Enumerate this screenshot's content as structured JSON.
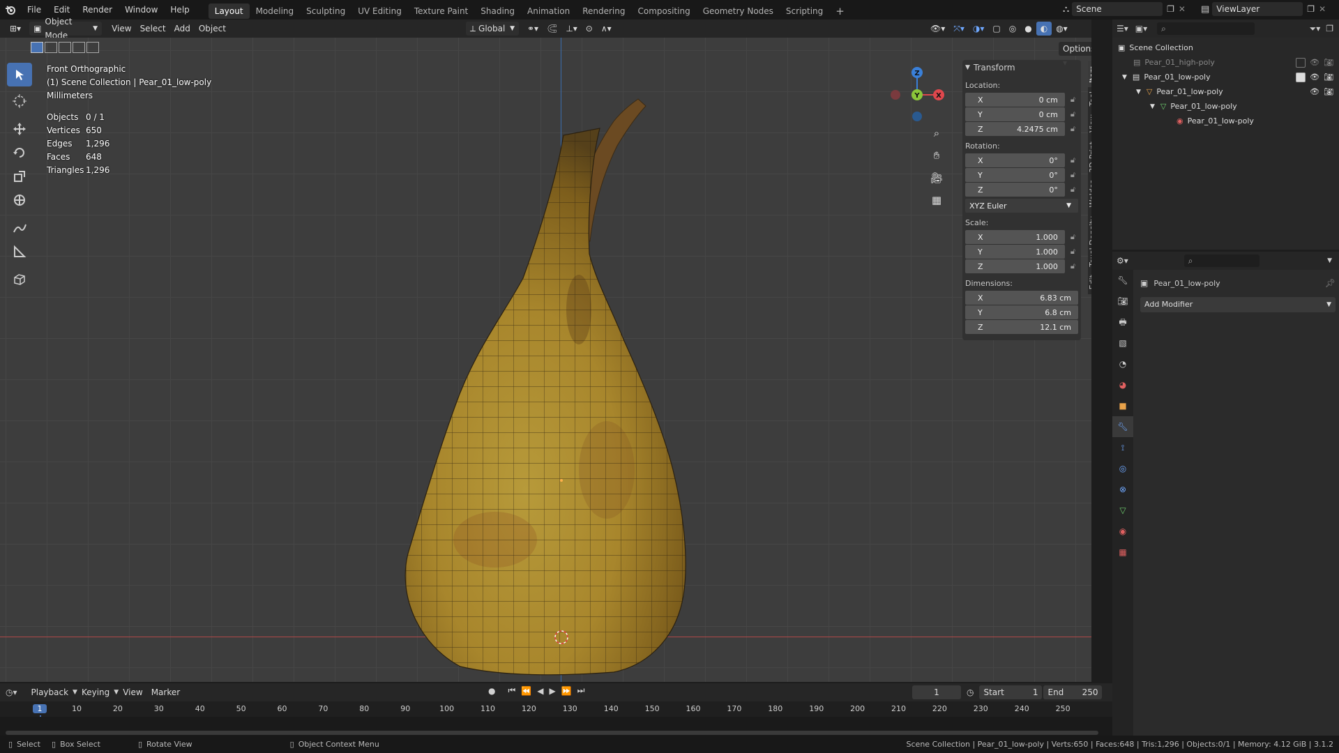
{
  "menubar": {
    "items": [
      "File",
      "Edit",
      "Render",
      "Window",
      "Help"
    ],
    "workspaces": [
      "Layout",
      "Modeling",
      "Sculpting",
      "UV Editing",
      "Texture Paint",
      "Shading",
      "Animation",
      "Rendering",
      "Compositing",
      "Geometry Nodes",
      "Scripting"
    ],
    "active_workspace": "Layout",
    "add_tab": "+",
    "scene_name": "Scene",
    "view_layer": "ViewLayer"
  },
  "viewport_header": {
    "mode": "Object Mode",
    "menus": [
      "View",
      "Select",
      "Add",
      "Object"
    ],
    "transform_orientation": "Global",
    "options_label": "Options"
  },
  "viewport_overlay": {
    "view_name": "Front Orthographic",
    "collection_path": "(1) Scene Collection | Pear_01_low-poly",
    "units": "Millimeters",
    "stats": [
      {
        "label": "Objects",
        "value": "0 / 1"
      },
      {
        "label": "Vertices",
        "value": "650"
      },
      {
        "label": "Edges",
        "value": "1,296"
      },
      {
        "label": "Faces",
        "value": "648"
      },
      {
        "label": "Triangles",
        "value": "1,296"
      }
    ]
  },
  "gizmo": {
    "z": "Z",
    "y": "Y",
    "x": "X"
  },
  "npanel": {
    "header": "Transform",
    "location_label": "Location:",
    "location": [
      {
        "axis": "X",
        "value": "0 cm"
      },
      {
        "axis": "Y",
        "value": "0 cm"
      },
      {
        "axis": "Z",
        "value": "4.2475 cm"
      }
    ],
    "rotation_label": "Rotation:",
    "rotation": [
      {
        "axis": "X",
        "value": "0°"
      },
      {
        "axis": "Y",
        "value": "0°"
      },
      {
        "axis": "Z",
        "value": "0°"
      }
    ],
    "rotation_mode": "XYZ Euler",
    "scale_label": "Scale:",
    "scale": [
      {
        "axis": "X",
        "value": "1.000"
      },
      {
        "axis": "Y",
        "value": "1.000"
      },
      {
        "axis": "Z",
        "value": "1.000"
      }
    ],
    "dimensions_label": "Dimensions:",
    "dimensions": [
      {
        "axis": "X",
        "value": "6.83 cm"
      },
      {
        "axis": "Y",
        "value": "6.8 cm"
      },
      {
        "axis": "Z",
        "value": "12.1 cm"
      }
    ]
  },
  "sidebar_tabs": [
    "Item",
    "Tool",
    "View",
    "3D-Print",
    "Welder",
    "Texel Density",
    "Edit"
  ],
  "outliner": {
    "root": "Scene Collection",
    "items": [
      {
        "name": "Pear_01_high-poly",
        "level": 1,
        "dim": true
      },
      {
        "name": "Pear_01_low-poly",
        "level": 1,
        "dim": false
      },
      {
        "name": "Pear_01_low-poly",
        "level": 2,
        "dim": false
      },
      {
        "name": "Pear_01_low-poly",
        "level": 3,
        "dim": false
      },
      {
        "name": "Pear_01_low-poly",
        "level": 4,
        "dim": false
      }
    ]
  },
  "properties": {
    "object_name": "Pear_01_low-poly",
    "add_modifier": "Add Modifier"
  },
  "timeline": {
    "menus": [
      "Playback",
      "Keying",
      "View",
      "Marker"
    ],
    "current_frame": "1",
    "start_label": "Start",
    "start": "1",
    "end_label": "End",
    "end": "250",
    "ticks": [
      "1",
      "10",
      "20",
      "30",
      "40",
      "50",
      "60",
      "70",
      "80",
      "90",
      "100",
      "110",
      "120",
      "130",
      "140",
      "150",
      "160",
      "170",
      "180",
      "190",
      "200",
      "210",
      "220",
      "230",
      "240",
      "250"
    ]
  },
  "statusbar": {
    "select": "Select",
    "box_select": "Box Select",
    "rotate_view": "Rotate View",
    "context_menu": "Object Context Menu",
    "info": "Scene Collection | Pear_01_low-poly | Verts:650 | Faces:648 | Tris:1,296 | Objects:0/1 | Memory: 4.12 GiB | 3.1.2"
  }
}
